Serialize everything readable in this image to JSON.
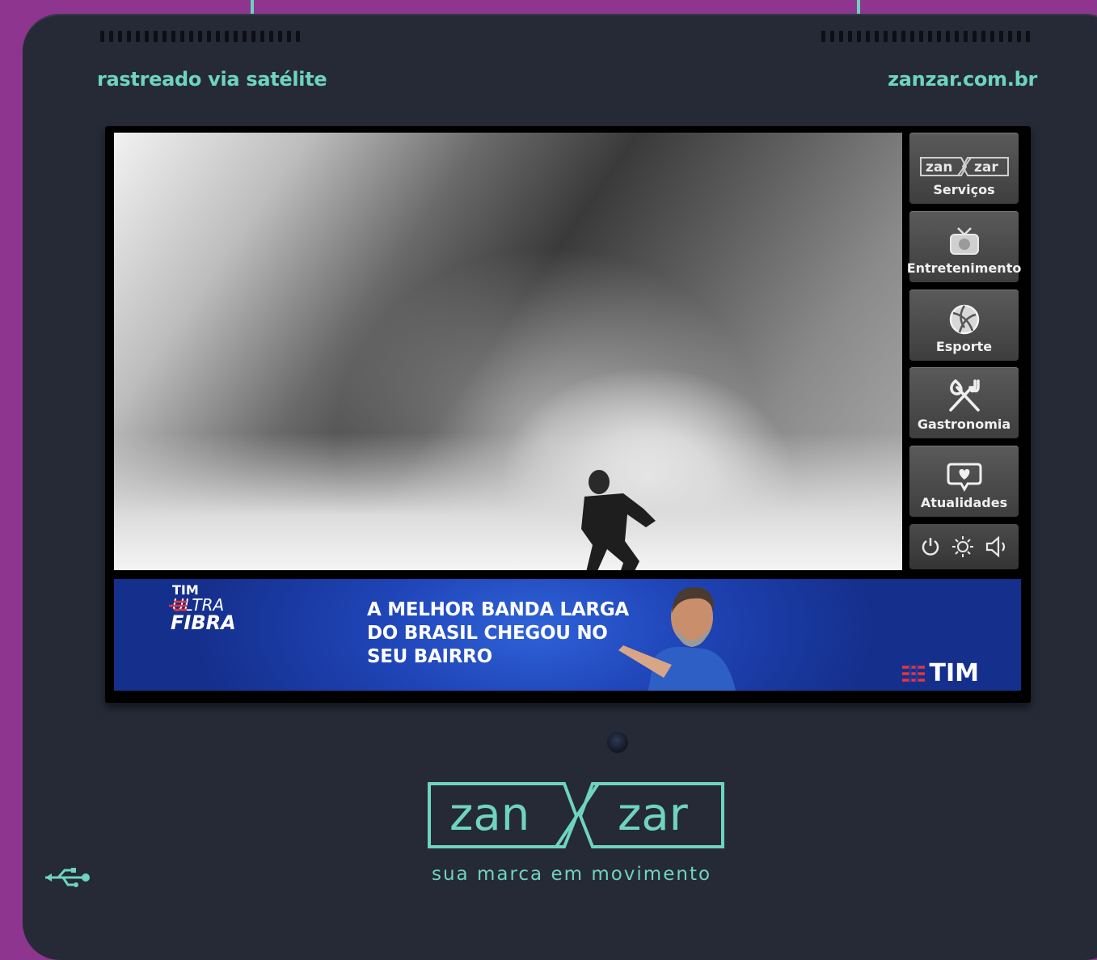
{
  "header": {
    "left_tagline": "rastreado via satélite",
    "right_website": "zanzar.com.br"
  },
  "sidebar": {
    "items": [
      {
        "label": "Serviços",
        "logo_left": "zan",
        "logo_right": "zar",
        "icon": "zanzar-logo-icon"
      },
      {
        "label": "Entretenimento",
        "icon": "tv-icon"
      },
      {
        "label": "Esporte",
        "icon": "volleyball-icon"
      },
      {
        "label": "Gastronomia",
        "icon": "utensils-icon"
      },
      {
        "label": "Atualidades",
        "icon": "heart-bubble-icon"
      }
    ],
    "controls": [
      "power-icon",
      "brightness-icon",
      "volume-icon"
    ]
  },
  "banner": {
    "brand_line1": "TIM",
    "brand_line2": "ULTRA",
    "brand_line3": "FIBRA",
    "headline": [
      "A MELHOR BANDA LARGA",
      "DO BRASIL CHEGOU NO",
      "SEU BAIRRO"
    ],
    "brand_right": "TIM"
  },
  "footer": {
    "logo_left": "zan",
    "logo_right": "zar",
    "slogan": "sua marca em movimento"
  },
  "colors": {
    "background": "#8e3590",
    "device": "#252a36",
    "accent": "#6fd4bf",
    "banner_blue": "#1f45b8",
    "tim_red": "#e8343b"
  }
}
